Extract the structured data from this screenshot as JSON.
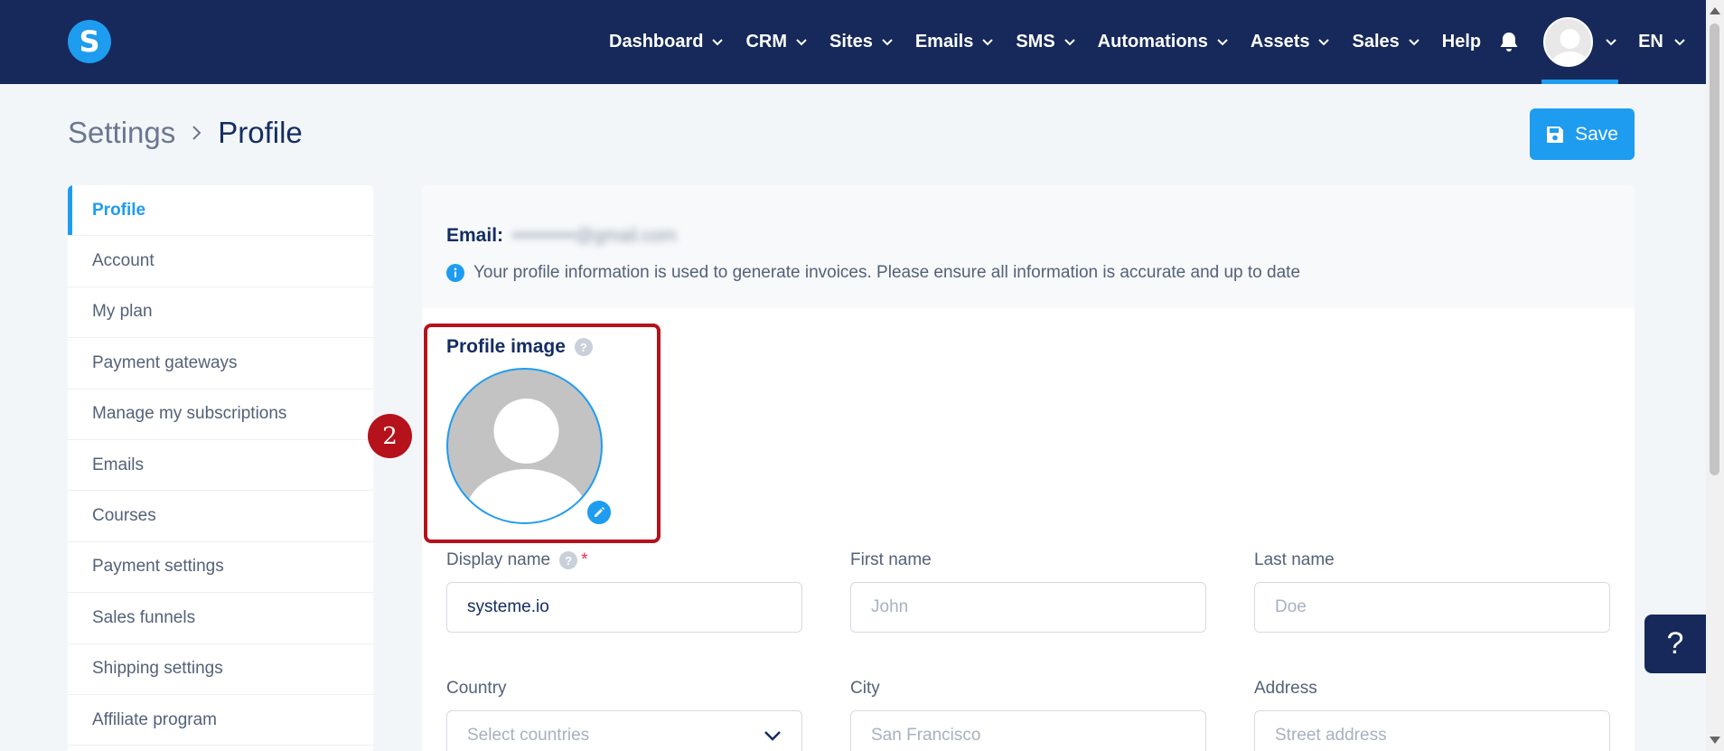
{
  "header": {
    "logo_letter": "S",
    "nav": [
      {
        "label": "Dashboard",
        "has_dropdown": true
      },
      {
        "label": "CRM",
        "has_dropdown": true
      },
      {
        "label": "Sites",
        "has_dropdown": true
      },
      {
        "label": "Emails",
        "has_dropdown": true
      },
      {
        "label": "SMS",
        "has_dropdown": true
      },
      {
        "label": "Automations",
        "has_dropdown": true
      },
      {
        "label": "Assets",
        "has_dropdown": true
      },
      {
        "label": "Sales",
        "has_dropdown": true
      },
      {
        "label": "Help",
        "has_dropdown": false
      }
    ],
    "language": "EN"
  },
  "breadcrumb": {
    "parent": "Settings",
    "current": "Profile"
  },
  "toolbar": {
    "save_label": "Save"
  },
  "sidebar": {
    "items": [
      {
        "label": "Profile",
        "active": true
      },
      {
        "label": "Account",
        "active": false
      },
      {
        "label": "My plan",
        "active": false
      },
      {
        "label": "Payment gateways",
        "active": false
      },
      {
        "label": "Manage my subscriptions",
        "active": false
      },
      {
        "label": "Emails",
        "active": false
      },
      {
        "label": "Courses",
        "active": false
      },
      {
        "label": "Payment settings",
        "active": false
      },
      {
        "label": "Sales funnels",
        "active": false
      },
      {
        "label": "Shipping settings",
        "active": false
      },
      {
        "label": "Affiliate program",
        "active": false
      }
    ]
  },
  "profile": {
    "email_label": "Email:",
    "email_value": "••••••••••@gmail.com",
    "info_text": "Your profile information is used to generate invoices. Please ensure all information is accurate and up to date",
    "profile_image_label": "Profile image",
    "step_number": "2",
    "help_glyph": "?"
  },
  "form": {
    "display_name": {
      "label": "Display name",
      "value": "systeme.io",
      "required_mark": "*"
    },
    "first_name": {
      "label": "First name",
      "placeholder": "John"
    },
    "last_name": {
      "label": "Last name",
      "placeholder": "Doe"
    },
    "country": {
      "label": "Country",
      "placeholder": "Select countries"
    },
    "city": {
      "label": "City",
      "placeholder": "San Francisco"
    },
    "address": {
      "label": "Address",
      "placeholder": "Street address"
    }
  },
  "floating_help": "?",
  "colors": {
    "nav_bg": "#16295a",
    "accent": "#1e9cf0",
    "highlight": "#b5121b"
  }
}
